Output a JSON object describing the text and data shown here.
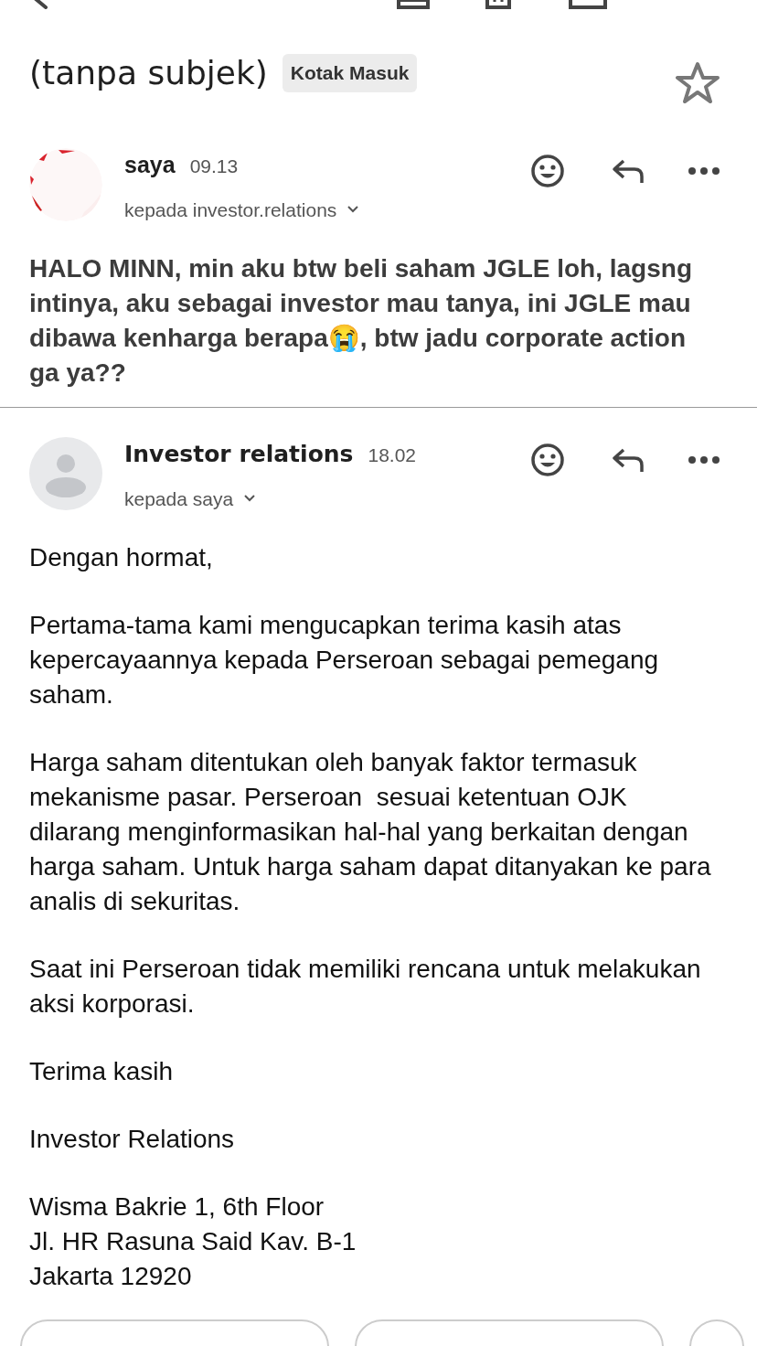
{
  "subject": "(tanpa subjek)",
  "label": "Kotak Masuk",
  "starred": false,
  "messages": [
    {
      "sender": "saya",
      "time": "09.13",
      "recipient": "kepada investor.relations",
      "avatar": {
        "kind": "picture"
      },
      "sender_bold": false,
      "paragraphs": [
        [
          "HALO MINN, min aku btw beli saham JGLE loh, lagsng intinya, aku sebagai investor mau tanya, ini JGLE mau dibawa kenharga berapa😭, btw jadu corporate action ga ya??"
        ]
      ]
    },
    {
      "sender": "Investor relations",
      "time": "18.02",
      "recipient": "kepada saya",
      "avatar": {
        "kind": "placeholder"
      },
      "sender_bold": true,
      "paragraphs": [
        [
          "Dengan hormat,"
        ],
        [
          "Pertama-tama kami mengucapkan terima kasih atas kepercayaannya kepada Perseroan sebagai pemegang saham."
        ],
        [
          "Harga saham ditentukan oleh banyak faktor termasuk mekanisme pasar. Perseroan  sesuai ketentuan OJK dilarang menginformasikan hal-hal yang berkaitan dengan harga saham. Untuk harga saham dapat ditanyakan ke para analis di sekuritas."
        ],
        [
          "Saat ini Perseroan tidak memiliki rencana untuk melakukan aksi korporasi."
        ],
        [
          "Terima kasih"
        ],
        [
          "Investor Relations"
        ],
        [
          "Wisma Bakrie 1, 6th Floor",
          "Jl. HR Rasuna Said Kav. B-1",
          "Jakarta 12920"
        ]
      ]
    }
  ]
}
